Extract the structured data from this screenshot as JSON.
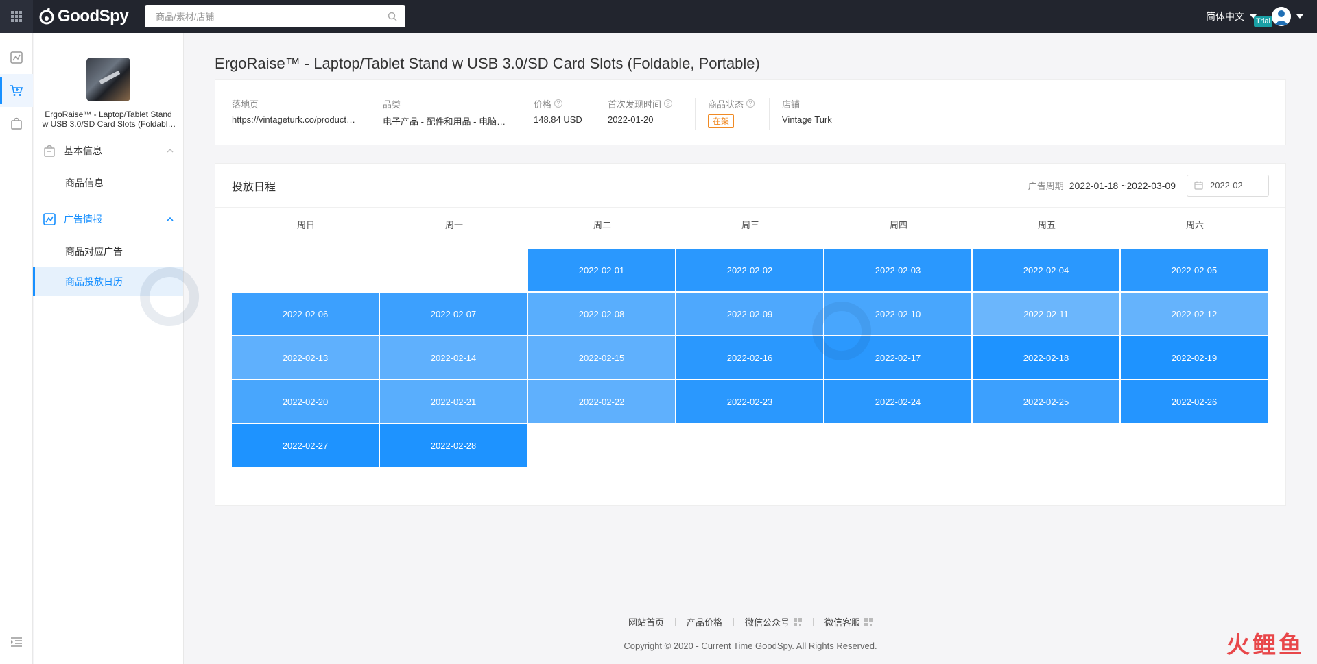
{
  "app": {
    "brand": "GoodSpy",
    "search_placeholder": "商品/素材/店铺",
    "language": "简体中文",
    "trial_label": "Trial"
  },
  "sidebar": {
    "product_name": "ErgoRaise™ - Laptop/Tablet Stand w USB 3.0/SD Card Slots (Foldable, Portable)",
    "groups": [
      {
        "label": "基本信息",
        "items": [
          {
            "label": "商品信息"
          }
        ]
      },
      {
        "label": "广告情报",
        "items": [
          {
            "label": "商品对应广告"
          },
          {
            "label": "商品投放日历"
          }
        ]
      }
    ]
  },
  "product": {
    "title": "ErgoRaise™ - Laptop/Tablet Stand w USB 3.0/SD Card Slots (Foldable, Portable)",
    "fields": [
      {
        "label": "落地页",
        "value": "https://vintageturk.co/products/ergoraise"
      },
      {
        "label": "品类",
        "value": "电子产品 - 配件和用品 - 电脑配件"
      },
      {
        "label": "价格",
        "value": "148.84 USD"
      },
      {
        "label": "首次发现时间",
        "value": "2022-01-20"
      },
      {
        "label": "商品状态",
        "value": "在架"
      },
      {
        "label": "店铺",
        "value": "Vintage Turk"
      }
    ]
  },
  "calendar": {
    "title": "投放日程",
    "period_label": "广告周期",
    "period_value": "2022-01-18 ~2022-03-09",
    "month": "2022-02",
    "weekdays": [
      "周日",
      "周一",
      "周二",
      "周三",
      "周四",
      "周五",
      "周六"
    ],
    "leading_empty": 2,
    "days": [
      {
        "date": "2022-02-01",
        "intensity": 0.85
      },
      {
        "date": "2022-02-02",
        "intensity": 0.85
      },
      {
        "date": "2022-02-03",
        "intensity": 0.85
      },
      {
        "date": "2022-02-04",
        "intensity": 0.85
      },
      {
        "date": "2022-02-05",
        "intensity": 0.85
      },
      {
        "date": "2022-02-06",
        "intensity": 0.7
      },
      {
        "date": "2022-02-07",
        "intensity": 0.7
      },
      {
        "date": "2022-02-08",
        "intensity": 0.45
      },
      {
        "date": "2022-02-09",
        "intensity": 0.55
      },
      {
        "date": "2022-02-10",
        "intensity": 0.6
      },
      {
        "date": "2022-02-11",
        "intensity": 0.3
      },
      {
        "date": "2022-02-12",
        "intensity": 0.35
      },
      {
        "date": "2022-02-13",
        "intensity": 0.4
      },
      {
        "date": "2022-02-14",
        "intensity": 0.4
      },
      {
        "date": "2022-02-15",
        "intensity": 0.4
      },
      {
        "date": "2022-02-16",
        "intensity": 0.85
      },
      {
        "date": "2022-02-17",
        "intensity": 0.85
      },
      {
        "date": "2022-02-18",
        "intensity": 0.95
      },
      {
        "date": "2022-02-19",
        "intensity": 0.95
      },
      {
        "date": "2022-02-20",
        "intensity": 0.6
      },
      {
        "date": "2022-02-21",
        "intensity": 0.45
      },
      {
        "date": "2022-02-22",
        "intensity": 0.4
      },
      {
        "date": "2022-02-23",
        "intensity": 0.85
      },
      {
        "date": "2022-02-24",
        "intensity": 0.85
      },
      {
        "date": "2022-02-25",
        "intensity": 0.7
      },
      {
        "date": "2022-02-26",
        "intensity": 0.9
      },
      {
        "date": "2022-02-27",
        "intensity": 0.95
      },
      {
        "date": "2022-02-28",
        "intensity": 0.95
      }
    ]
  },
  "footer": {
    "links": [
      "网站首页",
      "产品价格",
      "微信公众号",
      "微信客服"
    ],
    "copyright": "Copyright © 2020 - Current Time GoodSpy. All Rights Reserved."
  },
  "corner_brand": "火鲤鱼",
  "colors": {
    "accent": "#1890ff",
    "status": "#f08a24",
    "topbar": "#22252e"
  }
}
